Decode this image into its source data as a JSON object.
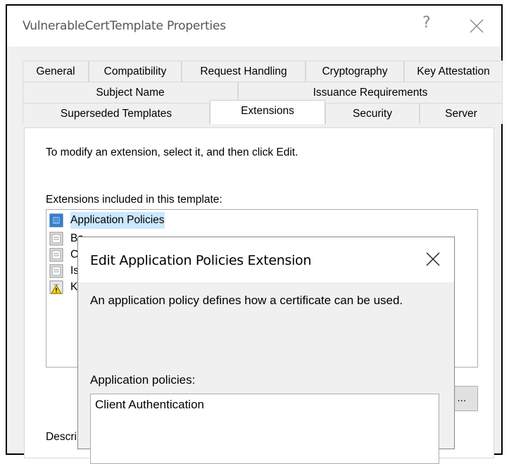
{
  "window": {
    "title": "VulnerableCertTemplate Properties",
    "help_glyph": "?"
  },
  "tabs": {
    "row1": [
      "General",
      "Compatibility",
      "Request Handling",
      "Cryptography",
      "Key Attestation"
    ],
    "row2": [
      "Subject Name",
      "Issuance Requirements"
    ],
    "row3": [
      "Superseded Templates",
      "Extensions",
      "Security",
      "Server"
    ],
    "active": "Extensions"
  },
  "panel": {
    "hint": "To modify an extension, select it, and then click Edit.",
    "list_label": "Extensions included in this template:",
    "extensions": [
      {
        "label": "Application Policies",
        "icon": "extension-icon",
        "selected": true
      },
      {
        "label": "Ba",
        "icon": "extension-icon"
      },
      {
        "label": "Ce",
        "icon": "extension-icon"
      },
      {
        "label": "Iss",
        "icon": "extension-icon"
      },
      {
        "label": "Ke",
        "icon": "extension-warning-icon"
      }
    ],
    "edit_button": "...",
    "description_label": "Descri"
  },
  "modal": {
    "title": "Edit Application Policies Extension",
    "description": "An application policy defines how a certificate can be used.",
    "policies_label": "Application policies:",
    "policies": [
      "Client Authentication"
    ]
  },
  "colors": {
    "selection": "#cce8ff",
    "dialog_bg": "#f0f0f0",
    "title_text": "#555555"
  }
}
